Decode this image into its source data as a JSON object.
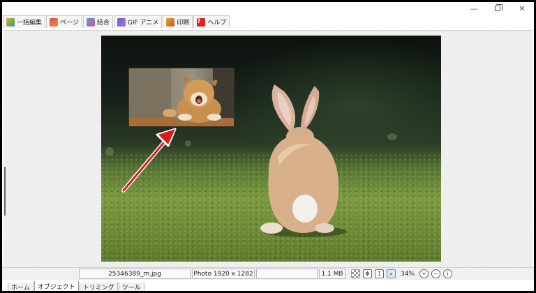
{
  "window": {
    "minimize_glyph": "—",
    "close_glyph": "✕"
  },
  "toolbar": {
    "items": [
      {
        "label": "一括編集",
        "icon": "batch-edit-icon"
      },
      {
        "label": "ページ",
        "icon": "page-icon"
      },
      {
        "label": "結合",
        "icon": "join-icon"
      },
      {
        "label": "GIF アニメ",
        "icon": "gif-animation-icon"
      },
      {
        "label": "印刷",
        "icon": "print-icon"
      },
      {
        "label": "ヘルプ",
        "icon": "help-icon"
      }
    ]
  },
  "status": {
    "filename": "25346389_m.jpg",
    "info": "Photo 1920 x 1282",
    "empty": "",
    "filesize": "1.1 MB",
    "zoom": "34%",
    "icons": [
      "transparency-checker-icon",
      "fit-screen-icon",
      "actual-size-icon",
      "zoom-fit-icon",
      "zoom-in-icon",
      "zoom-out-icon",
      "info-icon"
    ]
  },
  "tabs": {
    "items": [
      "ホーム",
      "オブジェクト",
      "トリミング",
      "ツール"
    ],
    "active_index": 1
  },
  "colors": {
    "arrow": "#d81b1b",
    "accent_active": "#dbe8f7"
  }
}
